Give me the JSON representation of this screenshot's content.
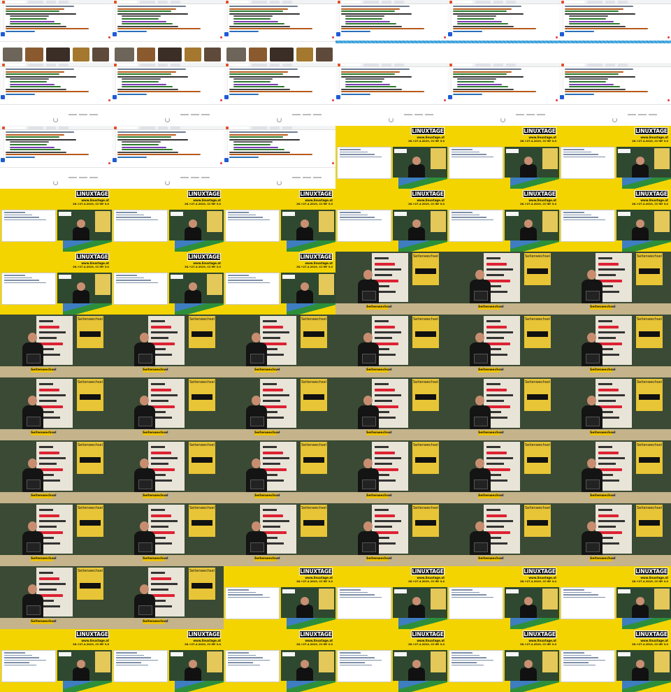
{
  "grid": {
    "columns": 6,
    "rows": 11
  },
  "slide_text": {
    "logo": "LINUXTAGE",
    "url": "www.linuxtage.at",
    "license": "26.+27.4.2019, CC-BY 3.0"
  },
  "stage_text": {
    "badge": "Seitenwechsel",
    "poster_title": "Seitenwechsel",
    "sponsor": "NETCOM"
  },
  "tiles": [
    "screen-img",
    "screen-img",
    "screen-img",
    "screen-blue",
    "screen-blue",
    "screen-blue",
    "screen-code",
    "screen-code",
    "screen-code",
    "screen-code",
    "screen-code",
    "screen-code",
    "screen-code",
    "screen-code",
    "screen-code",
    "slide",
    "slide",
    "slide",
    "slide",
    "slide",
    "slide",
    "slide",
    "slide",
    "slide",
    "slide",
    "slide",
    "slide",
    "stage",
    "stage",
    "stage",
    "stage",
    "stage",
    "stage",
    "stage",
    "stage",
    "stage",
    "stage",
    "stage",
    "stage",
    "stage",
    "stage",
    "stage",
    "stage",
    "stage",
    "stage",
    "stage",
    "stage",
    "stage",
    "stage",
    "stage",
    "stage",
    "stage",
    "stage",
    "stage",
    "stage",
    "stage",
    "slide",
    "slide",
    "slide",
    "slide",
    "slide-web",
    "slide-web",
    "slide-web",
    "slide-web",
    "slide-web",
    "slide-web"
  ],
  "colors": {
    "slide_yellow": "#f3d400",
    "stage_green": "#2e3d2c",
    "accent_blue": "#1e5bd6"
  }
}
